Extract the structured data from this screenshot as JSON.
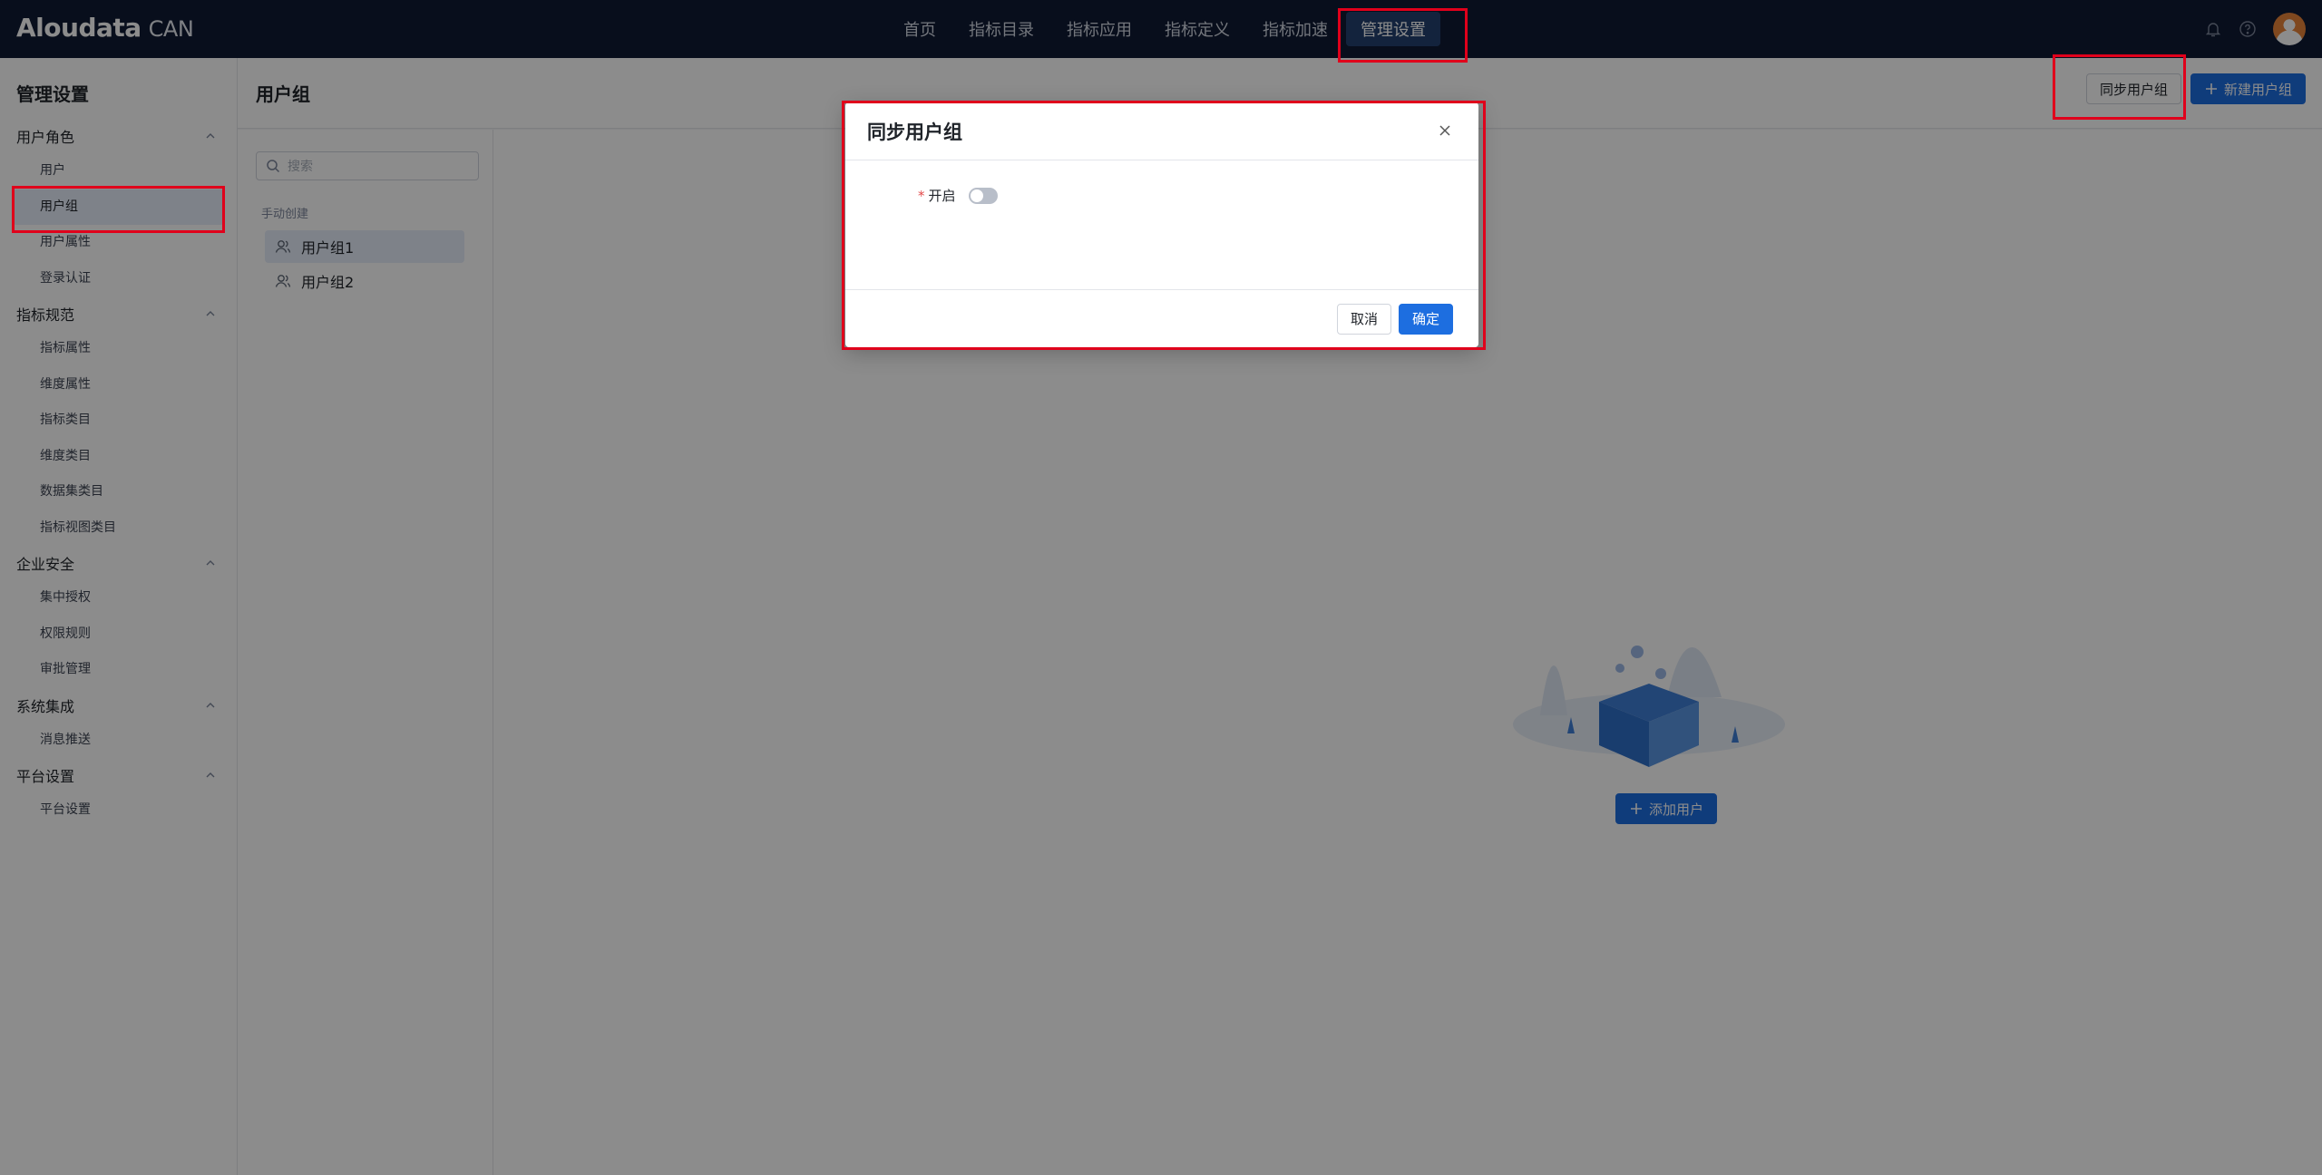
{
  "brand": {
    "name": "Aloudata",
    "product": "CAN"
  },
  "topnav": {
    "items": [
      {
        "label": "首页",
        "active": false
      },
      {
        "label": "指标目录",
        "active": false
      },
      {
        "label": "指标应用",
        "active": false
      },
      {
        "label": "指标定义",
        "active": false
      },
      {
        "label": "指标加速",
        "active": false
      },
      {
        "label": "管理设置",
        "active": true
      }
    ],
    "icons": [
      "notification-icon",
      "help-icon",
      "avatar"
    ]
  },
  "sidebar": {
    "title": "管理设置",
    "groups": [
      {
        "label": "用户角色",
        "items": [
          "用户",
          "用户组",
          "用户属性",
          "登录认证"
        ]
      },
      {
        "label": "指标规范",
        "items": [
          "指标属性",
          "维度属性",
          "指标类目",
          "维度类目",
          "数据集类目",
          "指标视图类目"
        ]
      },
      {
        "label": "企业安全",
        "items": [
          "集中授权",
          "权限规则",
          "审批管理"
        ]
      },
      {
        "label": "系统集成",
        "items": [
          "消息推送"
        ]
      },
      {
        "label": "平台设置",
        "items": [
          "平台设置"
        ]
      }
    ],
    "active_item": "用户组"
  },
  "page": {
    "title": "用户组",
    "sync_button": "同步用户组",
    "new_button": "新建用户组"
  },
  "list": {
    "search_placeholder": "搜索",
    "section_label": "手动创建",
    "groups": [
      "用户组1",
      "用户组2"
    ]
  },
  "main": {
    "add_user_button": "添加用户"
  },
  "modal": {
    "title": "同步用户组",
    "field_label": "开启",
    "required_mark": "*",
    "switch_on": false,
    "cancel_label": "取消",
    "confirm_label": "确定"
  },
  "colors": {
    "nav_bg": "#0f1a33",
    "primary": "#1d6ee0",
    "annotation": "#e0001b"
  }
}
